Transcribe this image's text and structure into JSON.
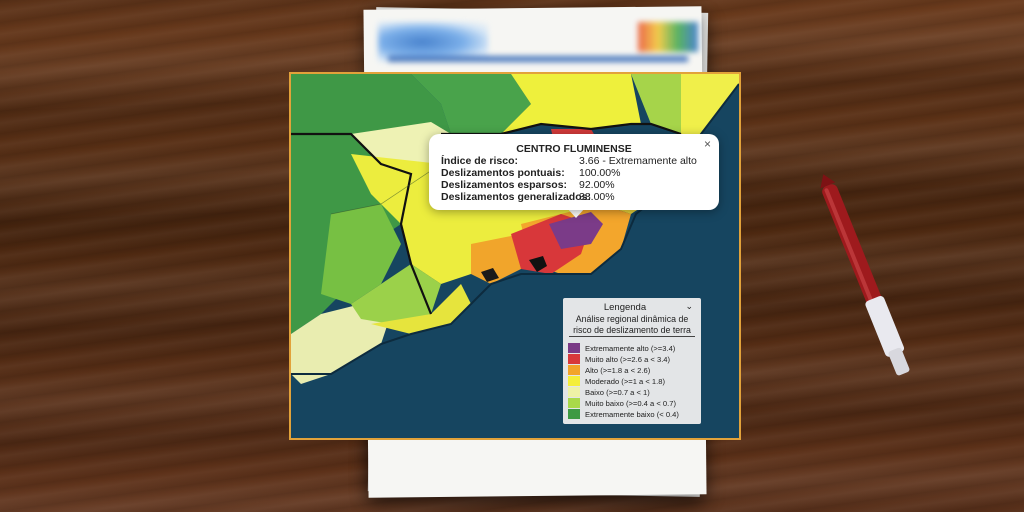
{
  "popup": {
    "title": "CENTRO FLUMINENSE",
    "close_symbol": "×",
    "rows": [
      {
        "label": "Índice de risco:",
        "value": "3.66 - Extremamente alto"
      },
      {
        "label": "Deslizamentos pontuais:",
        "value": "100.00%"
      },
      {
        "label": "Deslizamentos esparsos:",
        "value": "92.00%"
      },
      {
        "label": "Deslizamentos generalizados:",
        "value": "38.00%"
      }
    ]
  },
  "legend": {
    "title": "Lengenda",
    "chevron": "⌄",
    "subtitle_line1": "Análise regional dinâmica de",
    "subtitle_line2": "risco de deslizamento de terra",
    "items": [
      {
        "label": "Extremamente alto (>=3.4)",
        "color": "#7a3a86"
      },
      {
        "label": "Muito alto (>=2.6 a < 3.4)",
        "color": "#d8383a"
      },
      {
        "label": "Alto (>=1.8 a < 2.6)",
        "color": "#f2a42a"
      },
      {
        "label": "Moderado (>=1 a < 1.8)",
        "color": "#f4ee3a"
      },
      {
        "label": "Baixo (>=0.7 a < 1)",
        "color": "#eef2a6"
      },
      {
        "label": "Muito baixo (>=0.4 a < 0.7)",
        "color": "#a9d94a"
      },
      {
        "label": "Extremamente baixo (< 0.4)",
        "color": "#3e9a43"
      }
    ]
  },
  "colors": {
    "frame_border": "#e2a23a",
    "ocean": "#184863",
    "pen_body": "#a11a1d"
  }
}
